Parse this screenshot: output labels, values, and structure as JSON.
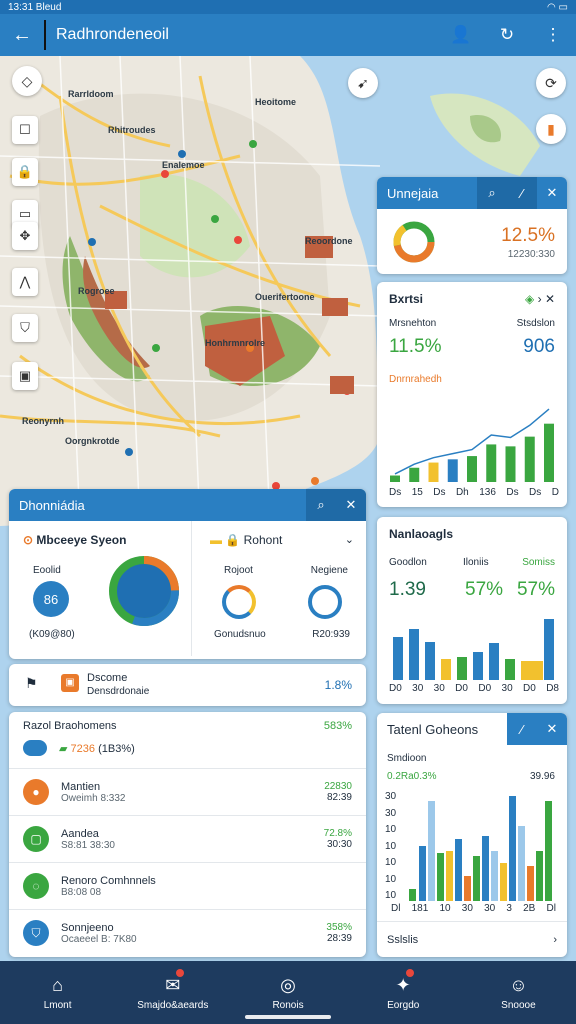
{
  "status": {
    "time": "13:31 Bleud"
  },
  "appbar": {
    "title": "Radhrondeneoil"
  },
  "map": {
    "labels": [
      "Rarrldoom",
      "Heoitome",
      "Rhitroudes",
      "Enalemoe",
      "Reoordone",
      "Rogroee",
      "Ouerifertoone",
      "Honhrmnrolre",
      "Reonyrnh",
      "Oorgnkrotde"
    ]
  },
  "card1": {
    "title": "Unnejaia",
    "value": "12.5%",
    "sub": "12230:330"
  },
  "card2": {
    "title": "Bxrtsi",
    "l1": "Mrsnehton",
    "l2": "Stsdslon",
    "v1": "11.5%",
    "v2": "906",
    "note": "Dnrnrahedh"
  },
  "card2chart": {
    "values": [
      10,
      22,
      30,
      35,
      40,
      58,
      55,
      70,
      90
    ]
  },
  "card2ticks": [
    "Ds",
    "15",
    "Ds",
    "Dh",
    "136",
    "Ds",
    "Ds",
    "D"
  ],
  "card3": {
    "title": "Dhonniádia",
    "left_title": "Mbceeye Syeon",
    "left_label": "Eoolid",
    "left_value": "86",
    "left_sub": "(K09@80)",
    "right_title": "Rohont",
    "right_l1": "Rojoot",
    "right_l2": "Negiene",
    "right_sub1": "Gonudsnuo",
    "right_sub2": "R20:939"
  },
  "card4": {
    "title": "Nanlaoagls",
    "h1": "Goodlon",
    "h2": "Iloniis",
    "h3": "Somiss",
    "v1": "1.39",
    "v2": "57%",
    "v3": "57%"
  },
  "card4ticks": [
    "D0",
    "30",
    "30",
    "D0",
    "D0",
    "30",
    "D0",
    "D8"
  ],
  "notice": {
    "title": "Dscome",
    "sub": "Densdrdonaie",
    "value": "1.8%"
  },
  "list": {
    "header": "Razol Braohomens",
    "header_value": "583%",
    "chip": "7236",
    "chip_text": "(1B3%)",
    "items": [
      {
        "name": "Mantien",
        "sub": "Oweimh 8:332",
        "value": "22830",
        "value2": "82:39"
      },
      {
        "name": "Aandea",
        "sub": "S8:81 38:30",
        "value": "72.8%",
        "value2": "30:30"
      },
      {
        "name": "Renoro Comhnnels",
        "sub": "B8:08 08",
        "value": "",
        "value2": ""
      },
      {
        "name": "Sonnjeeno",
        "sub": "Ocaeeel B: 7K80",
        "value": "358%",
        "value2": "28:39"
      }
    ]
  },
  "card5": {
    "title": "Tatenl Goheons",
    "sub": "Smdioon",
    "v1": "0.2Ra0.3%",
    "v2": "39.96",
    "footer": "Sslslis",
    "ticks": [
      "Dl",
      "181",
      "10",
      "30",
      "30",
      "3",
      "2B",
      "Dl"
    ],
    "yticks": [
      "30",
      "30",
      "10",
      "10",
      "10",
      "10",
      "10"
    ]
  },
  "nav": [
    "Lmont",
    "Smajdo&aeards",
    "Ronois",
    "Eorgdo",
    "Snoooe"
  ],
  "colors": {
    "primary": "#2a7fc2",
    "green": "#3aa640",
    "orange": "#e97a2b",
    "yellow": "#f2c12e",
    "nav": "#1e3b5f"
  }
}
